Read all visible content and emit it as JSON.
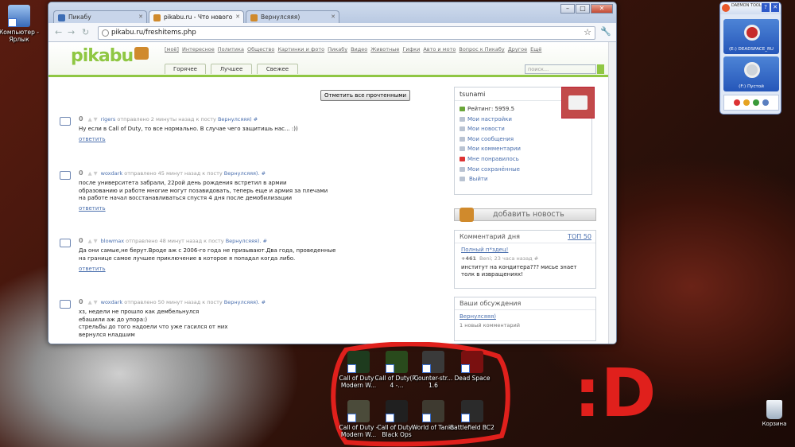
{
  "desktop": {
    "computer_icon_label": "Компьютер - Ярлык",
    "recycle_label": "Корзина",
    "games": [
      {
        "label": "Call of Duty - Modern W...",
        "color": "#1e3b1e"
      },
      {
        "label": "Call of Duty(R) 4 -...",
        "color": "#294a1c"
      },
      {
        "label": "Counter-str... 1.6",
        "color": "#3a3a3a"
      },
      {
        "label": "Dead Space",
        "color": "#7a1010"
      },
      {
        "label": "Call of Duty - Modern W...",
        "color": "#4b4b3a"
      },
      {
        "label": "Call of Duty - Black Ops",
        "color": "#202020"
      },
      {
        "label": "World of Tanks",
        "color": "#3e3a30"
      },
      {
        "label": "Battlefield BC2",
        "color": "#2b2b2b"
      }
    ],
    "annotation_color": "#e0201c"
  },
  "browser": {
    "tabs": [
      {
        "label": "Пикабу",
        "fav_color": "#3d6db5"
      },
      {
        "label": "pikabu.ru - Что нового",
        "fav_color": "#d08a2c"
      },
      {
        "label": "Вернулсяяя)",
        "fav_color": "#d08a2c"
      }
    ],
    "url": "pikabu.ru/freshitems.php"
  },
  "site": {
    "logo": "pikabu",
    "top_links": [
      "[моё]",
      "Интересное",
      "Политика",
      "Общество",
      "Картинки и фото",
      "Пикабу",
      "Видео",
      "Животные",
      "Гифки",
      "Авто и мото",
      "Вопрос к Пикабу",
      "Другое",
      "Ещё"
    ],
    "tabs": [
      "Горячее",
      "Лучшее",
      "Свежее"
    ],
    "search_placeholder": "поиск...",
    "mark_all_read": "Отметить все прочтенными",
    "comments": [
      {
        "score": "0",
        "user": "rigers",
        "sent": "отправлено 2 минуты назад к посту",
        "post": "Вернулсяяя)",
        "hash": "#",
        "text": "Ну если в Call of Duty, то все нормально. В случае чего защитишь нас... :))",
        "reply": "ответить"
      },
      {
        "score": "0",
        "user": "woxdark",
        "sent": "отправлено 45 минут назад к посту",
        "post": "Вернулсяяя).",
        "hash": "#",
        "text": "после университета забрали, 22рой день рождения встретил в армии\nобразованию и работе многие могут позавидовать, теперь еще и армия за плечами\nна работе начал восстанавливаться спустя 4 дня после демобилизации",
        "reply": "ответить"
      },
      {
        "score": "0",
        "user": "blowmax",
        "sent": "отправлено 48 минут назад к посту",
        "post": "Вернулсяяя).",
        "hash": "#",
        "text": "Да они самые,не берут.Вроде аж с 2006-го года не призывают.Два года, проведенные\nна границе самое лучшее приключение в которое я попадал когда либо.",
        "reply": "ответить"
      },
      {
        "score": "0",
        "user": "woxdark",
        "sent": "отправлено 50 минут назад к посту",
        "post": "Вернулсяяя).",
        "hash": "#",
        "text": "хз, недели не прошло как дембельнулся\nебашили аж до упора:)\nстрельбы до того надоели что уже гасился от них\nвернулся нладшим",
        "reply": ""
      }
    ],
    "user": {
      "name": "tsunami",
      "items": [
        "Рейтинг: 5959.5",
        "Мои настройки",
        "Мои новости",
        "Мои сообщения",
        "Мои комментарии",
        "Мне понравилось",
        "Мои сохранённые",
        "Выйти"
      ]
    },
    "add_news": "добавить новость",
    "day_comment": {
      "title": "Комментарий дня",
      "top": "ТОП 50",
      "link": "Полный п*здец!",
      "score": "+461",
      "meta": "Beni; 23 часа назад",
      "hash": "#",
      "text": "институт на кондитера??? мисье знает толк в извращениях!"
    },
    "discussions": {
      "title": "Ваши обсуждения",
      "link": "Вернулсяяя)",
      "sub": "1 новый комментарий"
    }
  },
  "daemon": {
    "brand": "DAEMON TOOLS",
    "drive1": "(E:) DEADSPACE_RU",
    "drive2": "(F:) Пустой"
  },
  "scribble_text": ":D"
}
